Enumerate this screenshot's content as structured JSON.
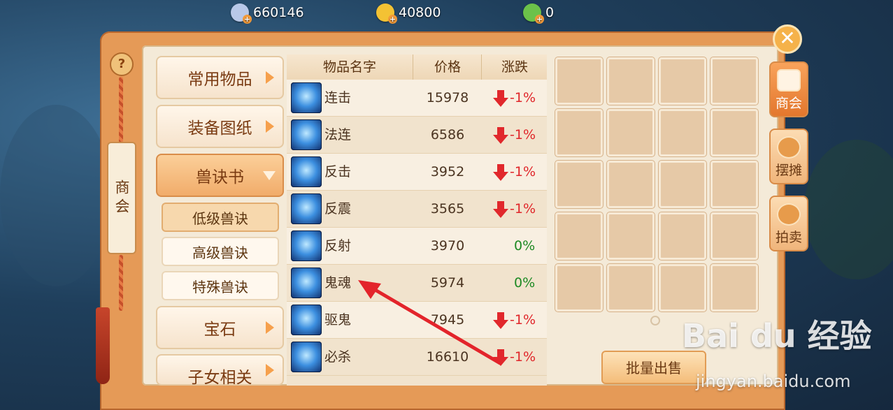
{
  "currency": [
    {
      "icon": "silver-coin-icon",
      "value": "660146",
      "color": "#b8c8e8"
    },
    {
      "icon": "gold-coin-icon",
      "value": "40800",
      "color": "#f3c234"
    },
    {
      "icon": "jade-coin-icon",
      "value": "0",
      "color": "#6cc24a"
    }
  ],
  "sidebar": {
    "help_label": "?",
    "tag_label": "商会"
  },
  "categories": [
    {
      "label": "常用物品",
      "active": false
    },
    {
      "label": "装备图纸",
      "active": false
    },
    {
      "label": "兽诀书",
      "active": true
    },
    {
      "label": "宝石",
      "active": false
    },
    {
      "label": "子女相关",
      "active": false
    }
  ],
  "subcategories": [
    {
      "label": "低级兽诀",
      "active": true
    },
    {
      "label": "高级兽诀",
      "active": false
    },
    {
      "label": "特殊兽诀",
      "active": false
    }
  ],
  "table": {
    "headers": [
      "物品名字",
      "价格",
      "涨跌"
    ],
    "rows": [
      {
        "name": "连击",
        "price": "15978",
        "change": "-1%",
        "trend": "down"
      },
      {
        "name": "法连",
        "price": "6586",
        "change": "-1%",
        "trend": "down"
      },
      {
        "name": "反击",
        "price": "3952",
        "change": "-1%",
        "trend": "down"
      },
      {
        "name": "反震",
        "price": "3565",
        "change": "-1%",
        "trend": "down"
      },
      {
        "name": "反射",
        "price": "3970",
        "change": "0%",
        "trend": "flat"
      },
      {
        "name": "鬼魂",
        "price": "5974",
        "change": "0%",
        "trend": "flat"
      },
      {
        "name": "驱鬼",
        "price": "7945",
        "change": "-1%",
        "trend": "down"
      },
      {
        "name": "必杀",
        "price": "16610",
        "change": "-1%",
        "trend": "down"
      }
    ]
  },
  "actions": {
    "batch_sell": "批量出售"
  },
  "right_tabs": [
    {
      "label": "商会",
      "active": true
    },
    {
      "label": "摆摊",
      "active": false
    },
    {
      "label": "拍卖",
      "active": false
    }
  ],
  "watermark": {
    "main": "Bai du 经验",
    "sub": "jingyan.baidu.com"
  },
  "colors": {
    "down": "#e0262a",
    "flat": "#1e8a24",
    "panel": "#e59a57"
  }
}
